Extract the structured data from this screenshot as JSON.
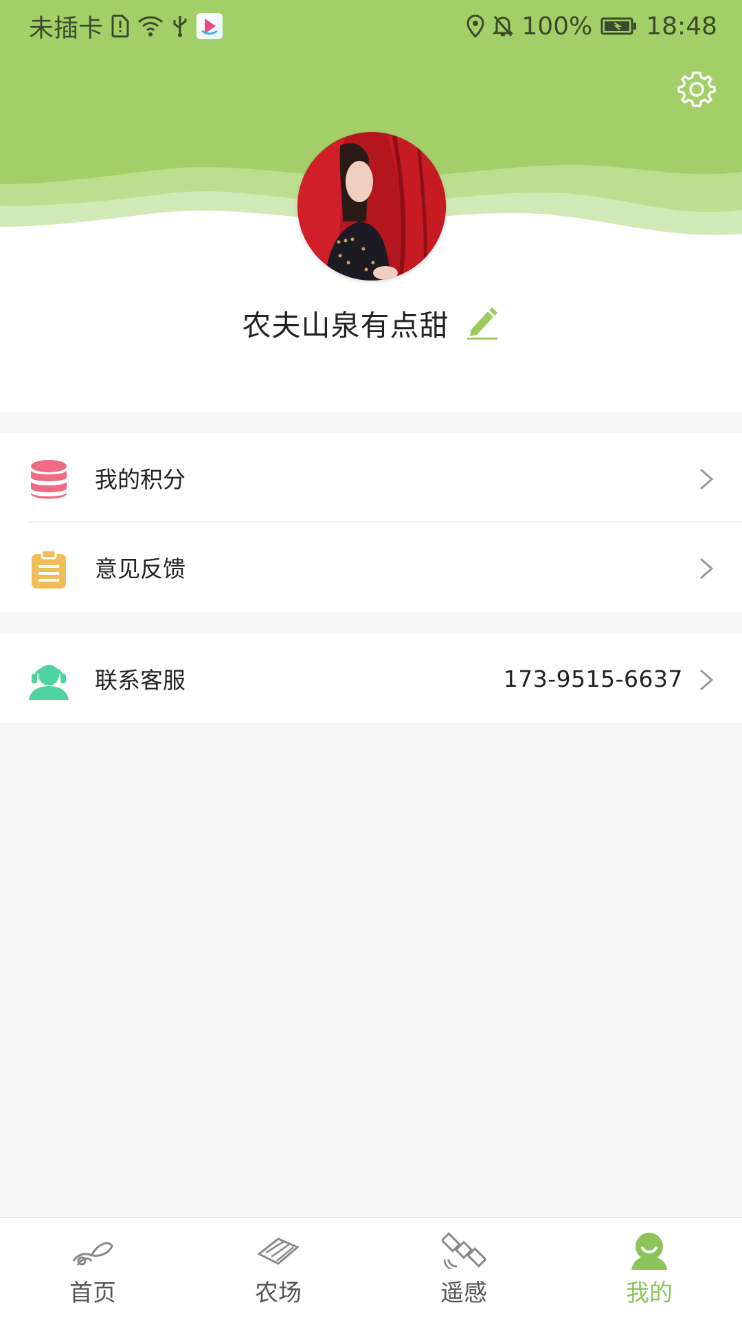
{
  "status_bar": {
    "carrier": "未插卡",
    "battery": "100%",
    "time": "18:48"
  },
  "profile": {
    "username": "农夫山泉有点甜"
  },
  "menu": {
    "points_label": "我的积分",
    "feedback_label": "意见反馈",
    "support_label": "联系客服",
    "support_phone": "173-9515-6637"
  },
  "bottom_nav": {
    "home": "首页",
    "farm": "农场",
    "remote": "遥感",
    "mine": "我的"
  },
  "colors": {
    "brand_green": "#a3cf68",
    "active_green": "#8cc45a",
    "points_pink": "#ef6a83",
    "feedback_yellow": "#efbe57",
    "support_teal": "#4fd3a0"
  }
}
